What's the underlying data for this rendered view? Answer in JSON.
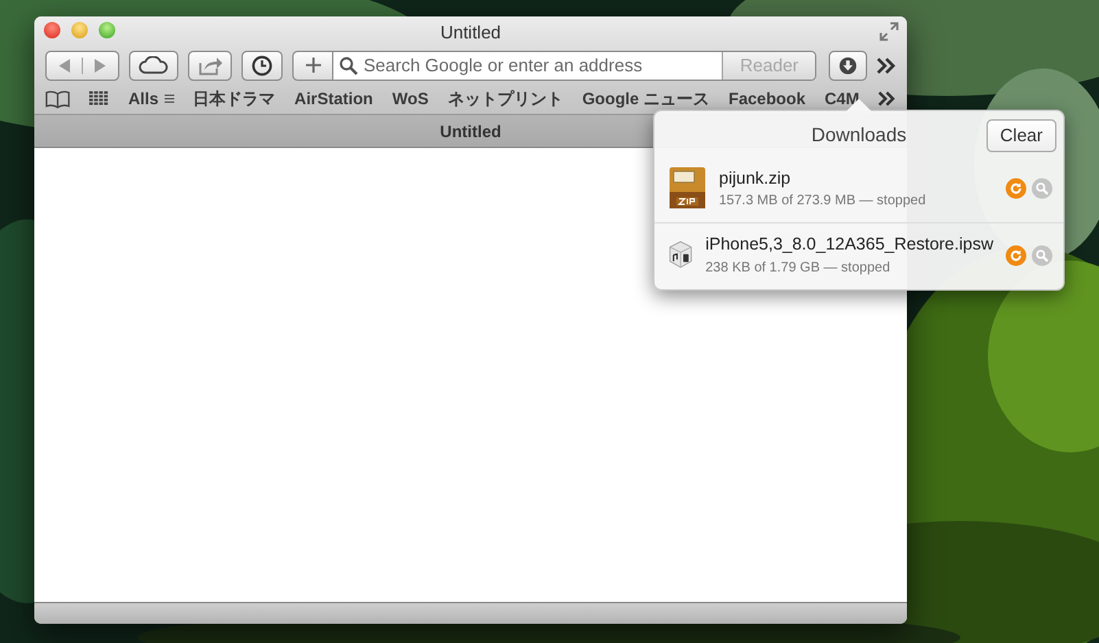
{
  "window": {
    "title": "Untitled"
  },
  "toolbar": {
    "search": {
      "placeholder": "Search Google or enter an address"
    },
    "reader_button": {
      "label": "Reader",
      "disabled": true
    }
  },
  "bookmarks": [
    {
      "label": "Alls",
      "kind": "folder"
    },
    {
      "label": "日本ドラマ",
      "kind": "link"
    },
    {
      "label": "AirStation",
      "kind": "link"
    },
    {
      "label": "WoS",
      "kind": "link"
    },
    {
      "label": "ネットプリント",
      "kind": "link"
    },
    {
      "label": "Google ニュース",
      "kind": "link"
    },
    {
      "label": "Facebook",
      "kind": "link"
    },
    {
      "label": "C4M",
      "kind": "link"
    }
  ],
  "tabs": [
    {
      "label": "Untitled"
    }
  ],
  "downloads": {
    "title": "Downloads",
    "clear_button": "Clear",
    "items": [
      {
        "name": "pijunk.zip",
        "status": "157.3 MB of 273.9 MB — stopped",
        "kind": "zip"
      },
      {
        "name": "iPhone5,3_8.0_12A365_Restore.ipsw",
        "status": "238 KB of 1.79 GB — stopped",
        "kind": "ipsw"
      }
    ]
  }
}
